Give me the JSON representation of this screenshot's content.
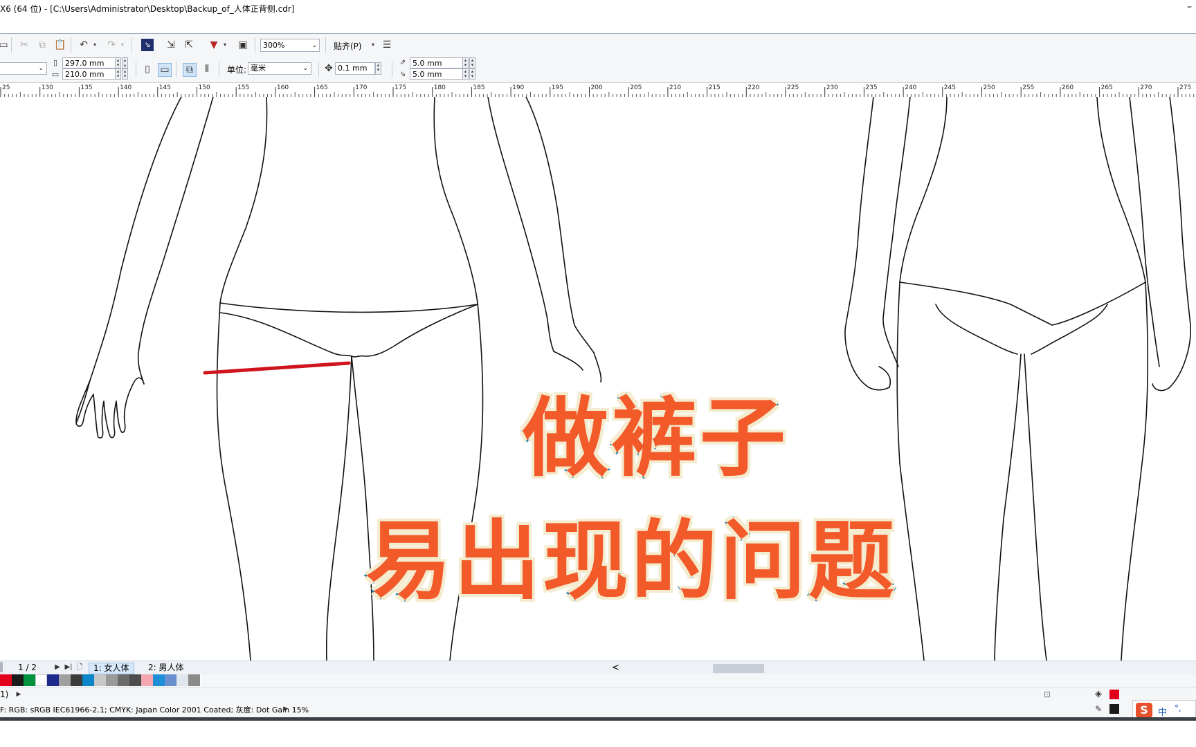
{
  "window": {
    "title": "X6 (64 位) - [C:\\Users\\Administrator\\Desktop\\Backup_of_人体正背侧.cdr]",
    "minimize_glyph": "–"
  },
  "toolbar": {
    "zoom_value": "300%",
    "snap_label": "贴齐(P)",
    "page_width": "297.0 mm",
    "page_height": "210.0 mm",
    "units_label": "单位:",
    "units_value": "毫米",
    "nudge_value": "0.1 mm",
    "duplicate_x": "5.0 mm",
    "duplicate_y": "5.0 mm"
  },
  "ruler": {
    "ticks": [
      "25",
      "130",
      "135",
      "140",
      "145",
      "150",
      "155",
      "160",
      "165",
      "170",
      "175",
      "180",
      "185",
      "190",
      "195",
      "200",
      "205",
      "210",
      "215",
      "220",
      "225",
      "230",
      "235",
      "240",
      "245",
      "250",
      "255",
      "260",
      "265",
      "270",
      "275"
    ]
  },
  "overlay": {
    "line1": "做裤子",
    "line2": "易出现的问题"
  },
  "pagebar": {
    "page_counter": "1 / 2",
    "tabs": [
      "1: 女人体",
      "2: 男人体"
    ],
    "scroll_left": "<"
  },
  "palette": {
    "colors": [
      "#e2001a",
      "#1a1a1a",
      "#00933d",
      "#ffffff",
      "#1d2a8c",
      "#a0a0a0",
      "#3b3b3b",
      "#0a86c9",
      "#c8c8c8",
      "#9a9a9a",
      "#6b6b6b",
      "#4d4d4d",
      "#f4a7b0",
      "#1d8fd6",
      "#6a8fcf",
      "#dfe6ee",
      "#8a8a8a"
    ]
  },
  "status": {
    "left_marker": "1)",
    "color_profile": "F: RGB: sRGB IEC61966-2.1; CMYK: Japan Color 2001 Coated; 灰度: Dot Gain 15%",
    "fill_color": "#e2001a",
    "outline_color": "#1a1a1a",
    "ime_label": "中",
    "ime_logo": "S"
  },
  "accent": {
    "measure_line": "#d0141c",
    "title_fill": "#f25a2a",
    "title_stroke": "#1e7fa8"
  }
}
